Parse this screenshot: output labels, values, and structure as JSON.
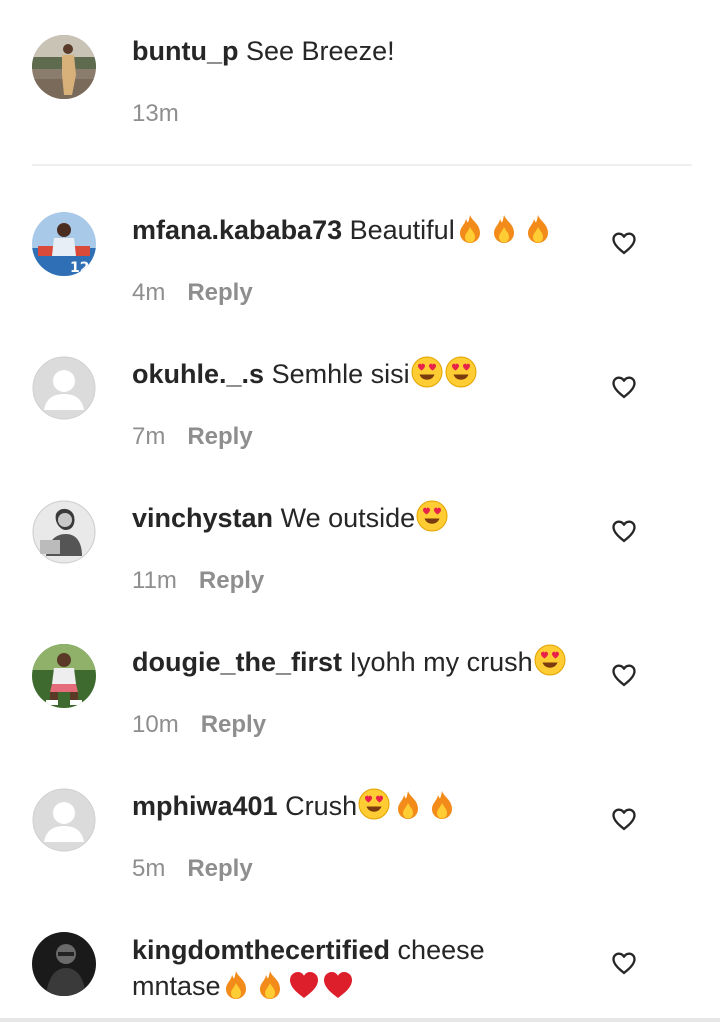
{
  "caption": {
    "username": "buntu_p",
    "text": "See Breeze!",
    "time": "13m"
  },
  "reply_label": "Reply",
  "comments": [
    {
      "username": "mfana.kababa73",
      "text": "Beautiful",
      "emojis": [
        "fire",
        "fire",
        "fire"
      ],
      "time": "4m",
      "avatar": "photo-sports"
    },
    {
      "username": "okuhle._.s",
      "text": "Semhle sisi",
      "emojis": [
        "heart-eyes",
        "heart-eyes"
      ],
      "time": "7m",
      "avatar": "default"
    },
    {
      "username": "vinchystan",
      "text": "We outside",
      "emojis": [
        "heart-eyes"
      ],
      "time": "11m",
      "avatar": "photo-person-bw"
    },
    {
      "username": "dougie_the_first",
      "text": "Iyohh my crush",
      "emojis": [
        "heart-eyes"
      ],
      "time": "10m",
      "avatar": "photo-person"
    },
    {
      "username": "mphiwa401",
      "text": "Crush",
      "emojis": [
        "heart-eyes",
        "fire",
        "fire"
      ],
      "time": "5m",
      "avatar": "default"
    },
    {
      "username": "kingdomthecertified",
      "text": "cheese mntase",
      "text_line1": "cheese",
      "text_line2": "mntase",
      "emojis": [
        "fire",
        "fire",
        "red-heart",
        "red-heart"
      ],
      "avatar": "photo-dark"
    }
  ],
  "icons": {
    "like": "heart-outline-icon"
  },
  "colors": {
    "text": "#262626",
    "secondary": "#8e8e8e",
    "divider": "#efefef"
  }
}
